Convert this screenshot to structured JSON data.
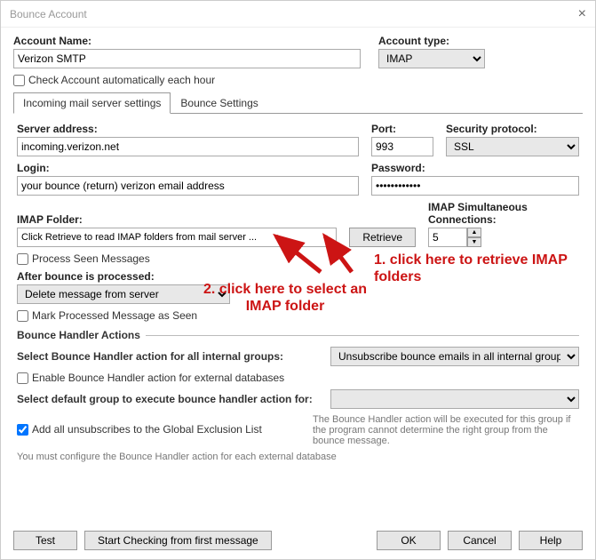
{
  "window": {
    "title": "Bounce Account"
  },
  "header": {
    "accountNameLabel": "Account Name:",
    "accountName": "Verizon SMTP",
    "accountTypeLabel": "Account type:",
    "accountType": "IMAP",
    "checkAuto": "Check Account automatically each hour"
  },
  "tabs": {
    "incoming": "Incoming mail server settings",
    "bounce": "Bounce Settings"
  },
  "incoming": {
    "serverLabel": "Server address:",
    "server": "incoming.verizon.net",
    "portLabel": "Port:",
    "port": "993",
    "securityLabel": "Security protocol:",
    "security": "SSL",
    "loginLabel": "Login:",
    "login": "your bounce (return) verizon email address",
    "passwordLabel": "Password:",
    "password": "••••••••••••",
    "imapFolderLabel": "IMAP Folder:",
    "imapFolder": "Click Retrieve to read IMAP folders from mail server ...",
    "retrieve": "Retrieve",
    "imapConnLabel": "IMAP Simultaneous Connections:",
    "imapConn": "5",
    "processSeen": "Process Seen Messages",
    "afterLabel": "After bounce is processed:",
    "afterAction": "Delete message from server",
    "markProcessed": "Mark Processed Message as Seen",
    "bhActions": "Bounce Handler Actions",
    "selectInternal": "Select Bounce Handler action for all internal groups:",
    "internalAction": "Unsubscribe bounce emails in all internal groups",
    "enableExternal": "Enable Bounce Handler action for external databases",
    "selectDefault": "Select default group to execute bounce handler action for:",
    "addUnsub": "Add all unsubscribes to the Global Exclusion List",
    "bhNote": "The Bounce Handler action will be executed for this group if the program cannot determine the right group from the bounce message.",
    "footNote": "You must configure the Bounce Handler action for each external database"
  },
  "footer": {
    "test": "Test",
    "start": "Start Checking from first message",
    "ok": "OK",
    "cancel": "Cancel",
    "help": "Help"
  },
  "annotations": {
    "a1": "1. click here to retrieve IMAP folders",
    "a2": "2. click here to select an IMAP folder"
  }
}
